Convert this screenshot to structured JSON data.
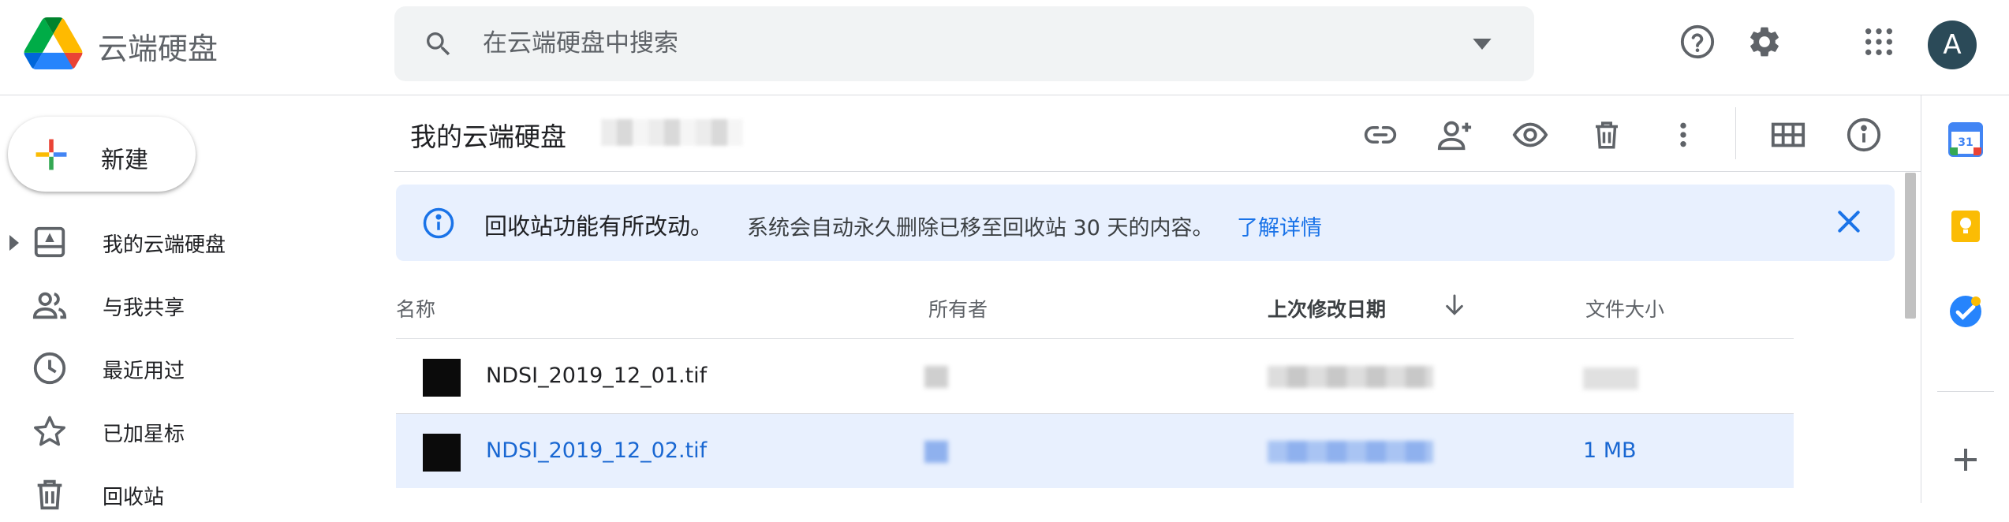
{
  "app": {
    "title": "云端硬盘"
  },
  "search": {
    "placeholder": "在云端硬盘中搜索"
  },
  "header": {
    "avatar_letter": "A"
  },
  "new_button": {
    "label": "新建"
  },
  "nav": {
    "items": [
      {
        "label": "我的云端硬盘"
      },
      {
        "label": "与我共享"
      },
      {
        "label": "最近用过"
      },
      {
        "label": "已加星标"
      },
      {
        "label": "回收站"
      }
    ]
  },
  "breadcrumb": {
    "title": "我的云端硬盘"
  },
  "banner": {
    "title": "回收站功能有所改动。",
    "text": "系统会自动永久删除已移至回收站 30 天的内容。",
    "link": "了解详情"
  },
  "table": {
    "columns": [
      "名称",
      "所有者",
      "上次修改日期",
      "文件大小"
    ],
    "rows": [
      {
        "name": "NDSI_2019_12_01.tif",
        "size": ""
      },
      {
        "name": "NDSI_2019_12_02.tif",
        "size": "1 MB",
        "selected": true
      }
    ]
  },
  "colors": {
    "accent": "#1a73e8",
    "selected_bg": "#e8f0fe",
    "banner_bg": "#e8f0fe"
  }
}
